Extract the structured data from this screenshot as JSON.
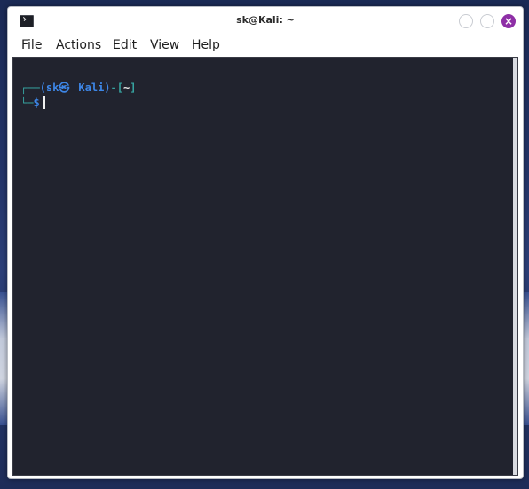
{
  "window": {
    "title": "sk@Kali: ~",
    "close_glyph": "×"
  },
  "menu": {
    "file": "File",
    "actions": "Actions",
    "edit": "Edit",
    "view": "View",
    "help": "Help"
  },
  "terminal": {
    "prompt": {
      "corner_top": "┌──",
      "open_paren": "(",
      "user": "sk",
      "host_symbol": "㉿",
      "host": "Kali",
      "close_paren": ")",
      "dash": "-",
      "open_bracket": "[",
      "cwd": "~",
      "close_bracket": "]",
      "corner_bottom": "└─",
      "symbol": "$"
    }
  },
  "colors": {
    "terminal_bg": "#21232e",
    "prompt_frame": "#36a3a0",
    "prompt_user": "#3d86e6",
    "close_button": "#8e2fa6"
  },
  "icons": {
    "app": "terminal-icon",
    "minimize": "minimize-icon",
    "maximize": "maximize-icon",
    "close": "close-icon"
  }
}
